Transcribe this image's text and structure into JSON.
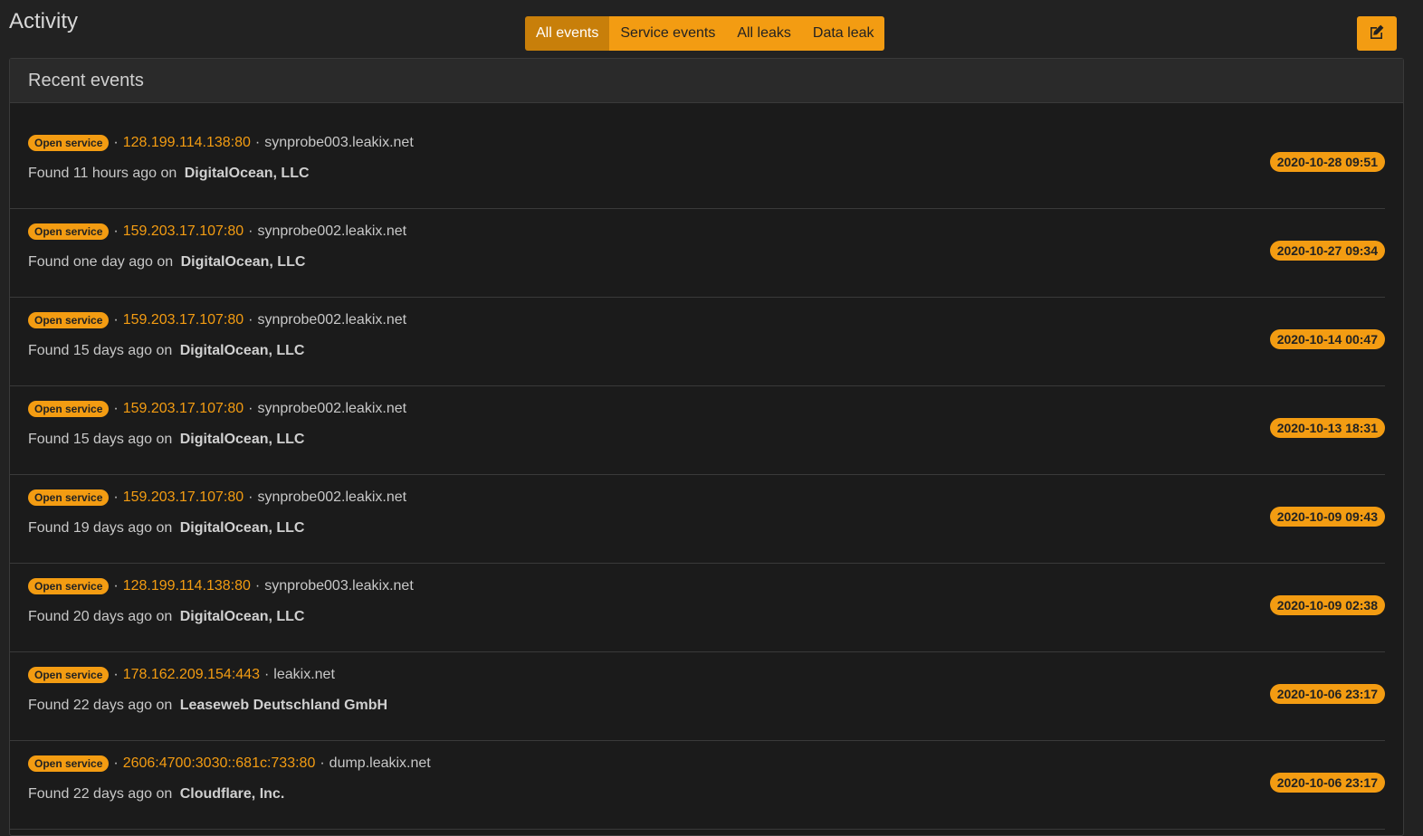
{
  "page": {
    "title": "Activity"
  },
  "tabs": [
    {
      "label": "All events",
      "active": true
    },
    {
      "label": "Service events",
      "active": false
    },
    {
      "label": "All leaks",
      "active": false
    },
    {
      "label": "Data leak",
      "active": false
    }
  ],
  "toolbar": {
    "edit_icon": "edit-icon"
  },
  "panel": {
    "title": "Recent events"
  },
  "events": [
    {
      "type": "Open service",
      "ip": "128.199.114.138:80",
      "host": "synprobe003.leakix.net",
      "found_prefix": "Found 11 hours ago on",
      "org": "DigitalOcean, LLC",
      "date": "2020-10-28 09:51"
    },
    {
      "type": "Open service",
      "ip": "159.203.17.107:80",
      "host": "synprobe002.leakix.net",
      "found_prefix": "Found one day ago on",
      "org": "DigitalOcean, LLC",
      "date": "2020-10-27 09:34"
    },
    {
      "type": "Open service",
      "ip": "159.203.17.107:80",
      "host": "synprobe002.leakix.net",
      "found_prefix": "Found 15 days ago on",
      "org": "DigitalOcean, LLC",
      "date": "2020-10-14 00:47"
    },
    {
      "type": "Open service",
      "ip": "159.203.17.107:80",
      "host": "synprobe002.leakix.net",
      "found_prefix": "Found 15 days ago on",
      "org": "DigitalOcean, LLC",
      "date": "2020-10-13 18:31"
    },
    {
      "type": "Open service",
      "ip": "159.203.17.107:80",
      "host": "synprobe002.leakix.net",
      "found_prefix": "Found 19 days ago on",
      "org": "DigitalOcean, LLC",
      "date": "2020-10-09 09:43"
    },
    {
      "type": "Open service",
      "ip": "128.199.114.138:80",
      "host": "synprobe003.leakix.net",
      "found_prefix": "Found 20 days ago on",
      "org": "DigitalOcean, LLC",
      "date": "2020-10-09 02:38"
    },
    {
      "type": "Open service",
      "ip": "178.162.209.154:443",
      "host": "leakix.net",
      "found_prefix": "Found 22 days ago on",
      "org": "Leaseweb Deutschland GmbH",
      "date": "2020-10-06 23:17"
    },
    {
      "type": "Open service",
      "ip": "2606:4700:3030::681c:733:80",
      "host": "dump.leakix.net",
      "found_prefix": "Found 22 days ago on",
      "org": "Cloudflare, Inc.",
      "date": "2020-10-06 23:17"
    }
  ],
  "colors": {
    "accent": "#f39c12",
    "accent_active": "#c87f0a",
    "background": "#222222"
  }
}
